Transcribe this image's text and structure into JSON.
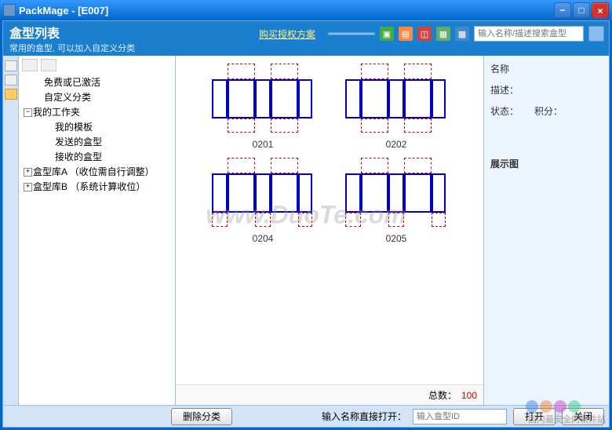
{
  "window": {
    "title": "PackMage - [E007]"
  },
  "header": {
    "title": "盒型列表",
    "subtitle": "常用的盒型, 可以加入自定义分类",
    "buy_link": "购买授权方案",
    "search_placeholder": "输入名称/描述搜索盒型"
  },
  "tree": {
    "items": [
      {
        "label": "免费或已激活",
        "type": "leaf"
      },
      {
        "label": "自定义分类",
        "type": "leaf"
      },
      {
        "label": "我的工作夹",
        "type": "expanded",
        "children": [
          {
            "label": "我的模板"
          },
          {
            "label": "发送的盒型"
          },
          {
            "label": "接收的盒型"
          }
        ]
      },
      {
        "label": "盒型库A （收位需自行调整）",
        "type": "collapsed"
      },
      {
        "label": "盒型库B （系统计算收位）",
        "type": "collapsed"
      }
    ]
  },
  "templates": {
    "row1": [
      {
        "id": "0201"
      },
      {
        "id": "0202"
      }
    ],
    "row2": [
      {
        "id": "0204"
      },
      {
        "id": "0205"
      }
    ],
    "total_label": "总数：",
    "total_value": "100"
  },
  "right": {
    "name_label": "名称",
    "desc_label": "描述：",
    "status_label": "状态：",
    "points_label": "积分：",
    "preview_label": "展示图"
  },
  "bottom": {
    "delete_category": "删除分类",
    "open_direct_label": "输入名称直接打开：",
    "id_placeholder": "输入盒型ID",
    "open_btn": "打开",
    "close_btn": "关闭"
  },
  "watermark": {
    "main": "www.DuoTe.com",
    "bottom": "国内最安全的软件站"
  }
}
